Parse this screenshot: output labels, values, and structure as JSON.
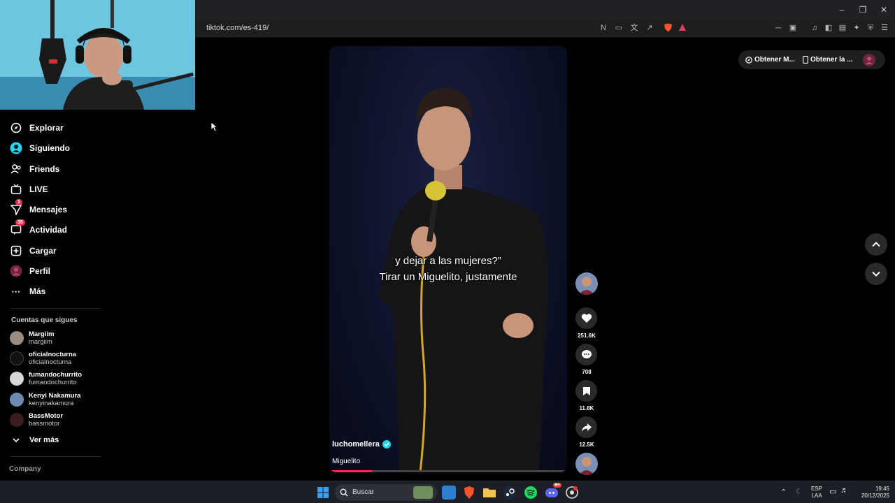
{
  "browser": {
    "url": "tiktok.com/es-419/",
    "window_controls": [
      "minimize",
      "restore",
      "close"
    ]
  },
  "sidebar": {
    "items": [
      {
        "label": "Explorar",
        "icon": "compass-icon"
      },
      {
        "label": "Siguiendo",
        "icon": "following-icon"
      },
      {
        "label": "Friends",
        "icon": "friends-icon"
      },
      {
        "label": "LIVE",
        "icon": "live-icon"
      },
      {
        "label": "Mensajes",
        "icon": "messages-icon",
        "badge": "1"
      },
      {
        "label": "Actividad",
        "icon": "activity-icon",
        "badge": "35"
      },
      {
        "label": "Cargar",
        "icon": "upload-icon"
      },
      {
        "label": "Perfil",
        "icon": "profile-icon"
      },
      {
        "label": "Más",
        "icon": "more-icon"
      }
    ],
    "following_title": "Cuentas que sigues",
    "following": [
      {
        "display": "Margiim",
        "user": "margiim"
      },
      {
        "display": "oficialnocturna",
        "user": "oficialnocturna"
      },
      {
        "display": "fumandochurrito",
        "user": "fumandochurrito"
      },
      {
        "display": "Kenyi Nakamura",
        "user": "kenyinakamura"
      },
      {
        "display": "BassMotor",
        "user": "bassmotor"
      }
    ],
    "see_more": "Ver más",
    "company": "Company"
  },
  "video": {
    "caption_line1": "y dejar a las mujeres?”",
    "caption_line2": "Tirar un Miguelito,  justamente",
    "author": "luchomellera",
    "description": "Miguelito",
    "progress": 0.18
  },
  "actions": {
    "likes": "251.6K",
    "comments": "708",
    "saves": "11.8K",
    "shares": "12.5K"
  },
  "top_right": {
    "get_app": "Obtener M...",
    "get_desktop": "Obtener la ..."
  },
  "taskbar": {
    "search_placeholder": "Buscar",
    "lang_line1": "ESP",
    "lang_line2": "LAA",
    "time": "19:45",
    "date": "20/12/2025",
    "discord_badge": "9+"
  },
  "colors": {
    "accent": "#fe2c55",
    "verified": "#20d5ec",
    "background": "#000000"
  }
}
